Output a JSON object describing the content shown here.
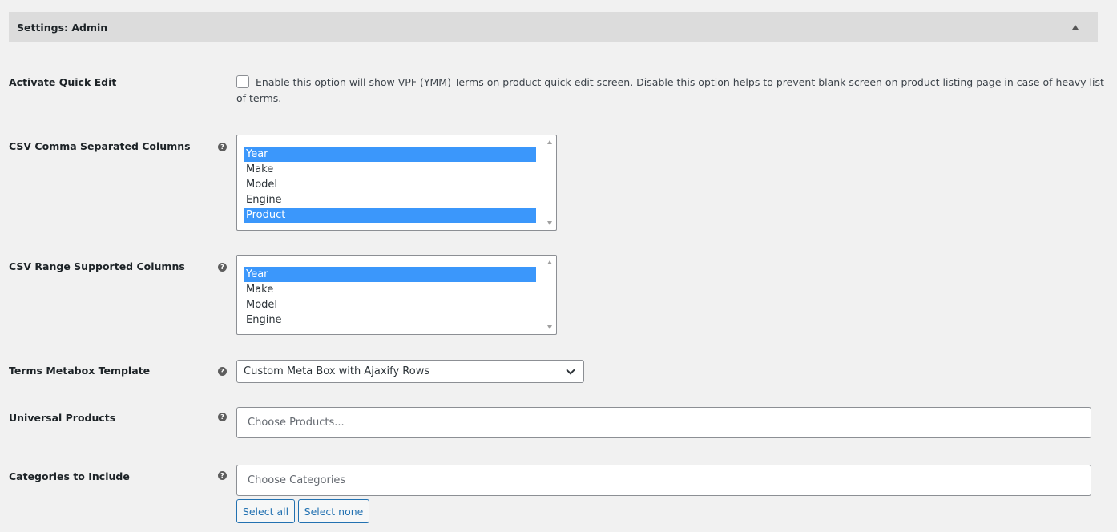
{
  "panel": {
    "title": "Settings: Admin"
  },
  "quick_edit": {
    "label": "Activate Quick Edit",
    "description": "Enable this option will show VPF (YMM) Terms on product quick edit screen. Disable this option helps to prevent blank screen on product listing page in case of heavy list of terms.",
    "checked": false
  },
  "csv_comma": {
    "label": "CSV Comma Separated Columns",
    "options": [
      {
        "label": "Year",
        "selected": true
      },
      {
        "label": "Make",
        "selected": false
      },
      {
        "label": "Model",
        "selected": false
      },
      {
        "label": "Engine",
        "selected": false
      },
      {
        "label": "Product",
        "selected": true
      }
    ]
  },
  "csv_range": {
    "label": "CSV Range Supported Columns",
    "options": [
      {
        "label": "Year",
        "selected": true
      },
      {
        "label": "Make",
        "selected": false
      },
      {
        "label": "Model",
        "selected": false
      },
      {
        "label": "Engine",
        "selected": false
      }
    ]
  },
  "metabox_template": {
    "label": "Terms Metabox Template",
    "value": "Custom Meta Box with Ajaxify Rows"
  },
  "universal_products": {
    "label": "Universal Products",
    "placeholder": "Choose Products..."
  },
  "categories": {
    "label": "Categories to Include",
    "placeholder": "Choose Categories",
    "select_all": "Select all",
    "select_none": "Select none"
  },
  "help_glyph": "?",
  "icons": {
    "help": "question-circle-icon",
    "toggle": "triangle-up-icon",
    "dropdown": "chevron-down-icon"
  },
  "colors": {
    "selection": "#3b97fb",
    "button_accent": "#2271b1",
    "panel_bg": "#dcdcdc"
  }
}
